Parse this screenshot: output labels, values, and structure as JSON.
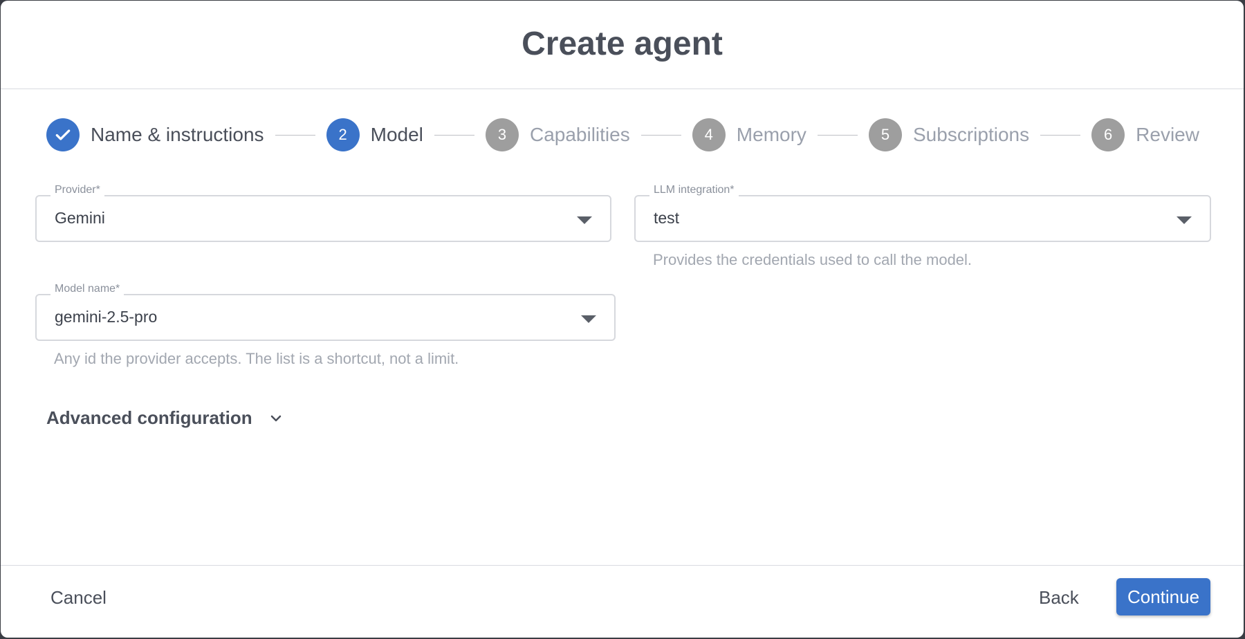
{
  "dialog": {
    "title": "Create agent"
  },
  "stepper": {
    "steps": [
      {
        "number": "1",
        "label": "Name & instructions",
        "state": "done"
      },
      {
        "number": "2",
        "label": "Model",
        "state": "active"
      },
      {
        "number": "3",
        "label": "Capabilities",
        "state": "pending"
      },
      {
        "number": "4",
        "label": "Memory",
        "state": "pending"
      },
      {
        "number": "5",
        "label": "Subscriptions",
        "state": "pending"
      },
      {
        "number": "6",
        "label": "Review",
        "state": "pending"
      }
    ]
  },
  "form": {
    "provider": {
      "label": "Provider",
      "required_mark": "*",
      "value": "Gemini"
    },
    "llm_integration": {
      "label": "LLM integration",
      "required_mark": "*",
      "value": "test",
      "helper": "Provides the credentials used to call the model."
    },
    "model_name": {
      "label": "Model name",
      "required_mark": "*",
      "value": "gemini-2.5-pro",
      "helper": "Any id the provider accepts. The list is a shortcut, not a limit."
    },
    "advanced": {
      "label": "Advanced configuration"
    }
  },
  "footer": {
    "cancel_label": "Cancel",
    "back_label": "Back",
    "continue_label": "Continue"
  },
  "colors": {
    "accent": "#3a73c9",
    "pending_step": "#9e9e9e"
  }
}
